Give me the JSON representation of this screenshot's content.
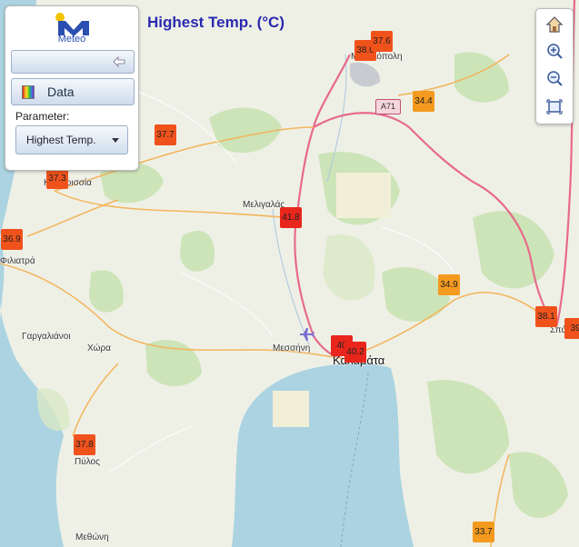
{
  "map": {
    "title": "Highest Temp. (°C)",
    "road_shield": "A71",
    "places": [
      {
        "id": "megalopoli",
        "label": "Μεγαλόπολη"
      },
      {
        "id": "kyparissia",
        "label": "Κυπαρισσία"
      },
      {
        "id": "meligalas",
        "label": "Μελιγαλάς"
      },
      {
        "id": "filiatra",
        "label": "Φιλιατρά"
      },
      {
        "id": "gargalianoi",
        "label": "Γαργαλιάνοι"
      },
      {
        "id": "chora",
        "label": "Χώρα"
      },
      {
        "id": "messini",
        "label": "Μεσσήνη"
      },
      {
        "id": "kalamata",
        "label": "Καλαμάτα"
      },
      {
        "id": "pylos",
        "label": "Πύλος"
      },
      {
        "id": "methoni",
        "label": "Μεθώνη"
      },
      {
        "id": "sparti",
        "label": "Σπάρτη"
      }
    ],
    "temperature_markers": [
      {
        "value": "38.6",
        "color": "#f0521c"
      },
      {
        "value": "37.6",
        "color": "#f0521c"
      },
      {
        "value": "34.4",
        "color": "#f49a1e"
      },
      {
        "value": "37.7",
        "color": "#f0521c"
      },
      {
        "value": "37.3",
        "color": "#f0521c"
      },
      {
        "value": "41.8",
        "color": "#e8261c"
      },
      {
        "value": "36.9",
        "color": "#f0521c"
      },
      {
        "value": "34.9",
        "color": "#f49a1e"
      },
      {
        "value": "38.1",
        "color": "#f0521c"
      },
      {
        "value": "39",
        "color": "#f0521c"
      },
      {
        "value": "40",
        "color": "#e8261c"
      },
      {
        "value": "40.2",
        "color": "#e8261c"
      },
      {
        "value": "37.8",
        "color": "#f0521c"
      },
      {
        "value": "33.7",
        "color": "#f49a1e"
      }
    ]
  },
  "panel": {
    "logo_text": "Meteo",
    "data_label": "Data",
    "parameter_label": "Parameter:",
    "parameter_value": "Highest Temp."
  },
  "zoom": {
    "buttons": [
      {
        "icon": "home-icon"
      },
      {
        "icon": "zoom-in-icon"
      },
      {
        "icon": "zoom-out-icon"
      },
      {
        "icon": "fullscreen-icon"
      }
    ]
  },
  "icons": {
    "collapse": "arrow-left-icon",
    "data": "color-palette-icon"
  }
}
